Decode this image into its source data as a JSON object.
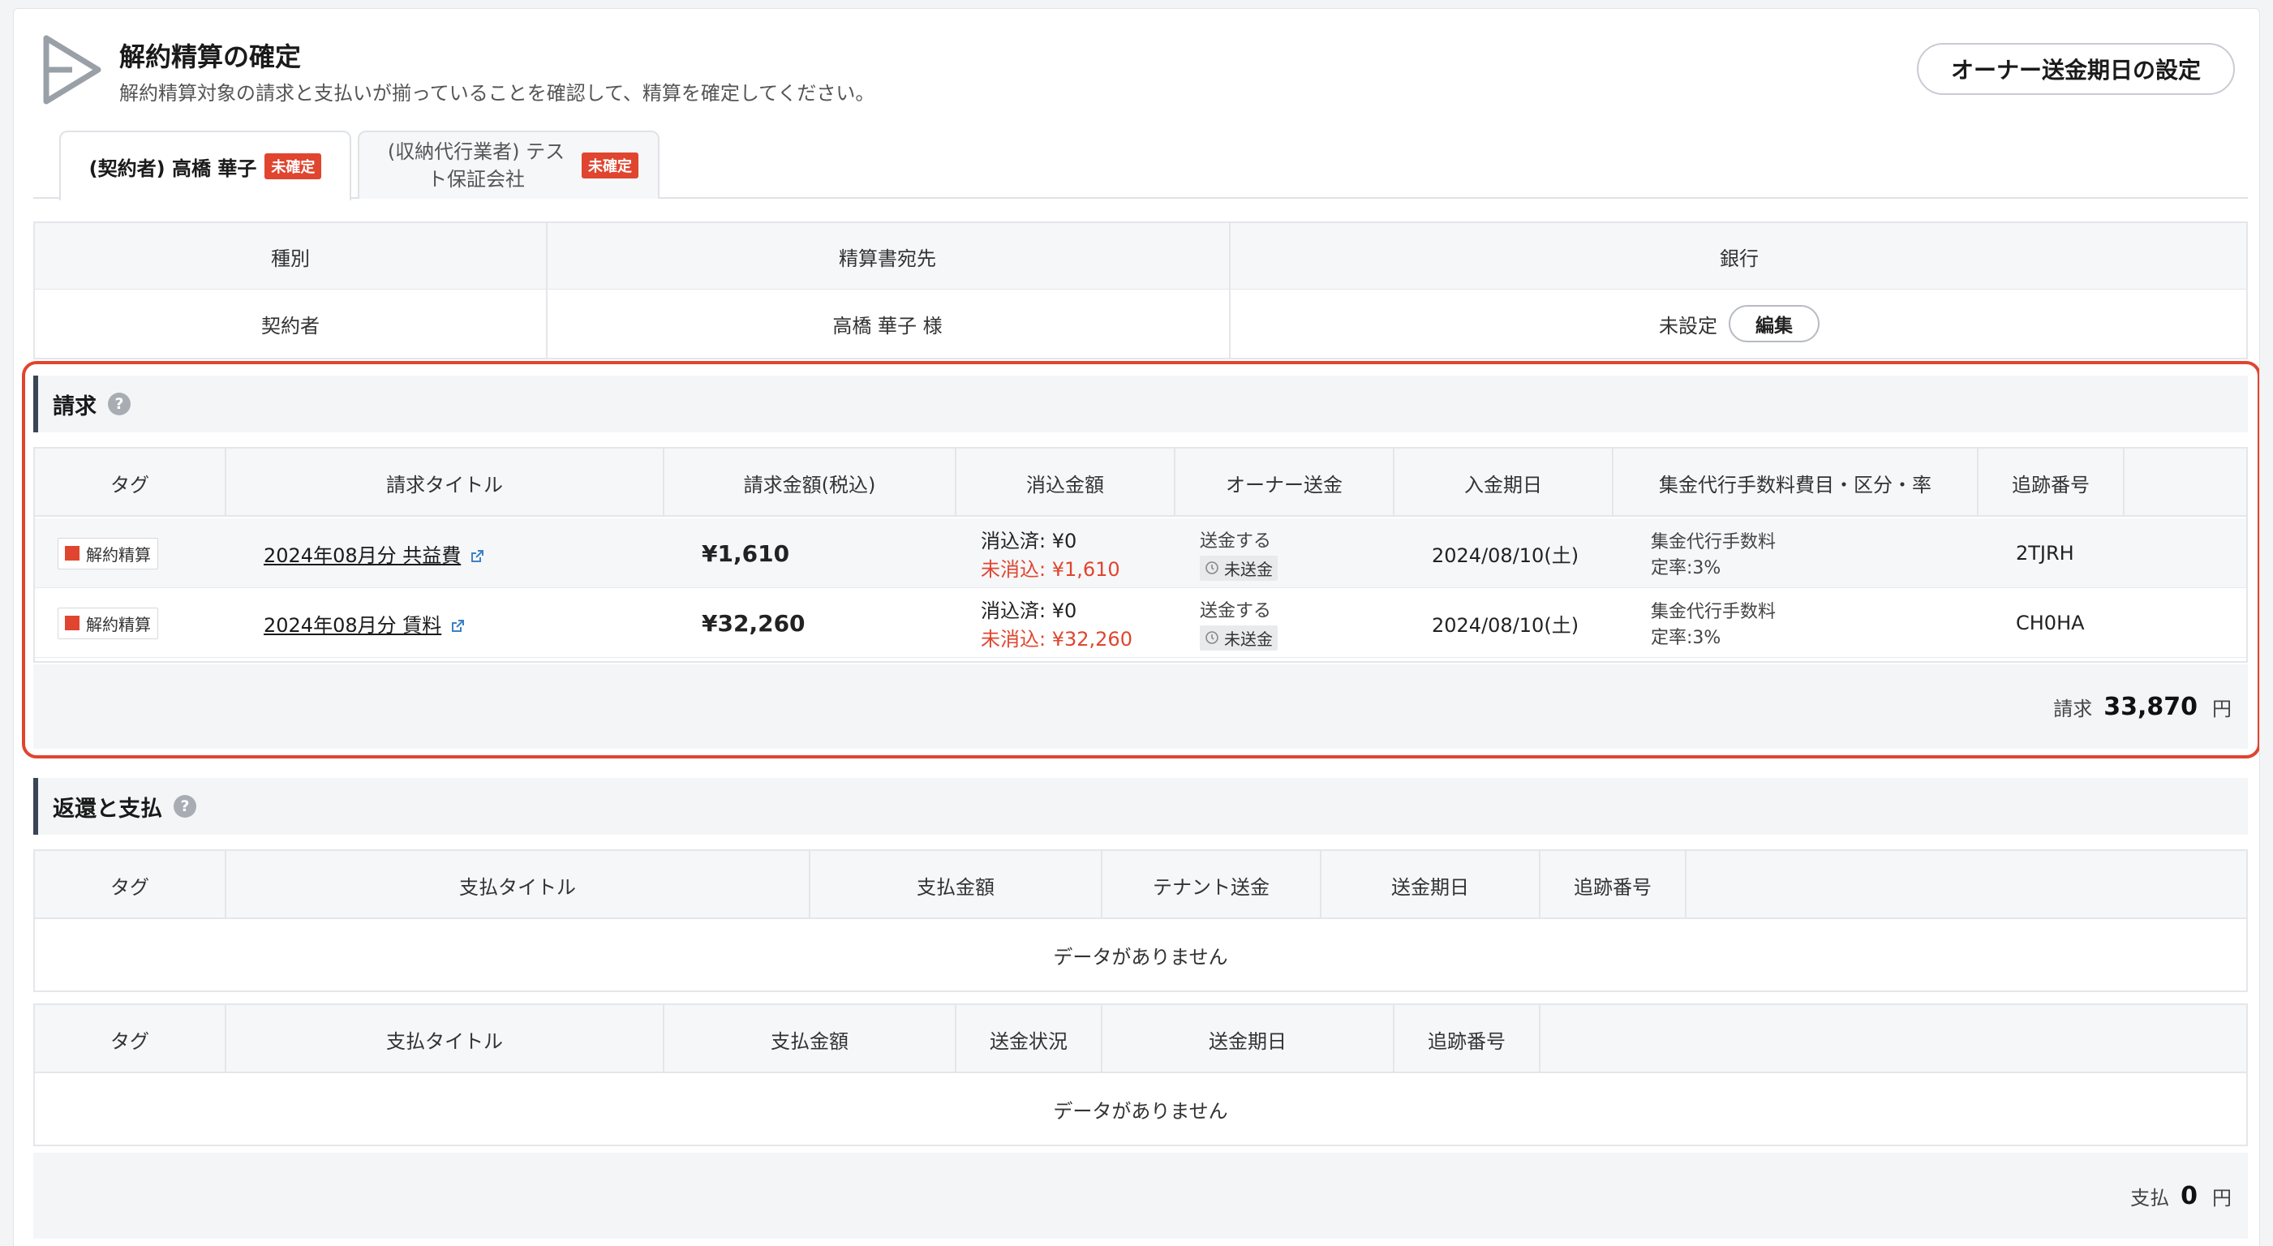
{
  "header": {
    "title": "解約精算の確定",
    "subtitle": "解約精算対象の請求と支払いが揃っていることを確認して、精算を確定してください。",
    "owner_button": "オーナー送金期日の設定"
  },
  "tabs": [
    {
      "label": "(契約者) 高橋 華子",
      "badge": "未確定",
      "active": true
    },
    {
      "label": "(収納代行業者) テスト保証会社",
      "badge": "未確定",
      "active": false
    }
  ],
  "info": {
    "headers": [
      "種別",
      "精算書宛先",
      "銀行"
    ],
    "values": [
      "契約者",
      "高橋 華子 様",
      "未設定"
    ],
    "edit_label": "編集"
  },
  "billing": {
    "title": "請求",
    "headers": [
      "タグ",
      "請求タイトル",
      "請求金額(税込)",
      "消込金額",
      "オーナー送金",
      "入金期日",
      "集金代行手数料費目・区分・率",
      "追跡番号"
    ],
    "rows": [
      {
        "tag": "解約精算",
        "title": "2024年08月分 共益費",
        "amount": "¥1,610",
        "applied": "消込済: ¥0",
        "unapplied": "未消込: ¥1,610",
        "owner": "送金する",
        "owner_status": "未送金",
        "due": "2024/08/10(土)",
        "fee": "集金代行手数料",
        "rate": "定率:3%",
        "tracking": "2TJRH"
      },
      {
        "tag": "解約精算",
        "title": "2024年08月分 賃料",
        "amount": "¥32,260",
        "applied": "消込済: ¥0",
        "unapplied": "未消込: ¥32,260",
        "owner": "送金する",
        "owner_status": "未送金",
        "due": "2024/08/10(土)",
        "fee": "集金代行手数料",
        "rate": "定率:3%",
        "tracking": "CH0HA"
      }
    ],
    "total_label": "請求",
    "total_value": "33,870",
    "unit": "円"
  },
  "refund": {
    "title": "返還と支払",
    "table1_headers": [
      "タグ",
      "支払タイトル",
      "支払金額",
      "テナント送金",
      "送金期日",
      "追跡番号"
    ],
    "table2_headers": [
      "タグ",
      "支払タイトル",
      "支払金額",
      "送金状況",
      "送金期日",
      "追跡番号"
    ],
    "empty": "データがありません",
    "total_label": "支払",
    "total_value": "0",
    "unit": "円"
  },
  "colors": {
    "accent_red": "#e0452f",
    "section_border": "#3a4556"
  }
}
